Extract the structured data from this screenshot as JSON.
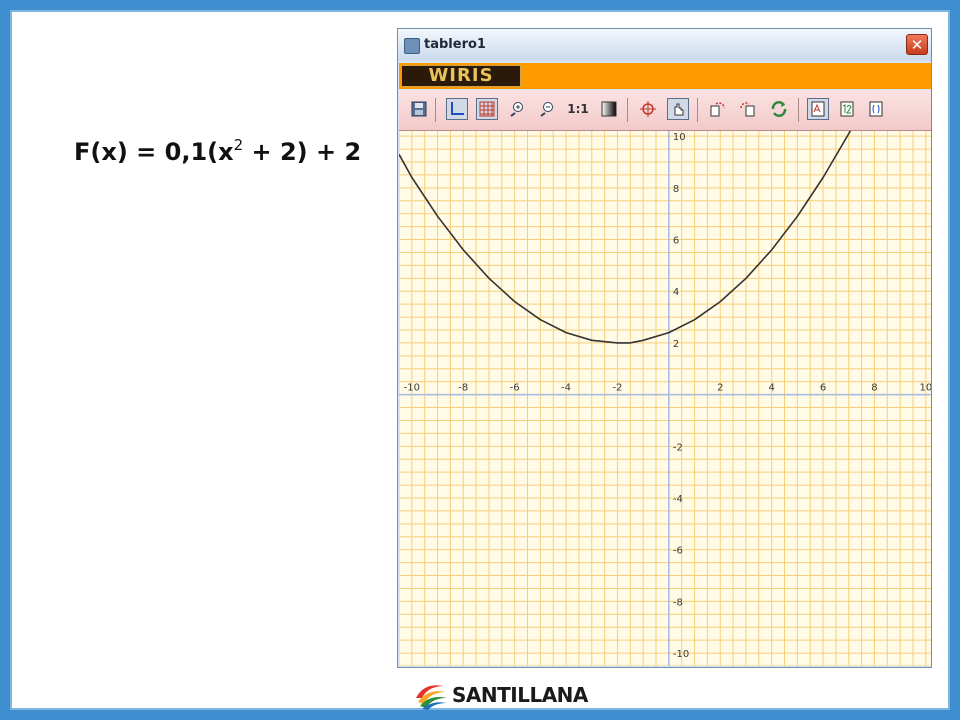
{
  "slide": {
    "equation_left": "F(x) = 0,1(x",
    "equation_sup": "2",
    "equation_right": " + 2) + 2"
  },
  "window": {
    "title": "tablero1",
    "close_glyph": "✕",
    "brand": "WIRIS",
    "toolbar": {
      "zoom_label": "1:1",
      "icons": [
        "save-icon",
        "axes-icon",
        "grid-icon",
        "zoom-in-icon",
        "zoom-out-icon",
        "zoom-reset-icon",
        "contrast-icon",
        "target-icon",
        "hand-icon",
        "undo-icon",
        "redo-icon",
        "refresh-icon",
        "text-icon",
        "number-icon",
        "formula-icon"
      ]
    }
  },
  "graph": {
    "x_ticks": [
      "-10",
      "-8",
      "-6",
      "-4",
      "-2",
      "2",
      "4",
      "6",
      "8",
      "10"
    ],
    "y_ticks": [
      "10",
      "8",
      "6",
      "4",
      "2",
      "-2",
      "-4",
      "-6",
      "-8",
      "-10"
    ],
    "colors": {
      "background": "#fffbe6",
      "grid": "#f6cf7a",
      "axes": "#a9b8e0",
      "curve": "#333333",
      "tick_label": "#3a3a3a"
    }
  },
  "chart_data": {
    "type": "line",
    "function": "F(x) = 0,1(x2 + 2) + 2",
    "xlim": [
      -10.5,
      10.2
    ],
    "ylim": [
      -10.5,
      10.2
    ],
    "grid": true,
    "series": [
      {
        "x": [
          -10.5,
          -10,
          -9,
          -8,
          -7,
          -6,
          -5,
          -4,
          -3,
          -2,
          -1.5,
          -1,
          0,
          1,
          2,
          3,
          4,
          5,
          6,
          7,
          7.5
        ],
        "values": [
          9.3,
          8.4,
          6.9,
          5.6,
          4.5,
          3.6,
          2.9,
          2.4,
          2.1,
          2.0,
          2.0,
          2.1,
          2.4,
          2.9,
          3.6,
          4.5,
          5.6,
          6.9,
          8.4,
          10.1,
          11.0
        ]
      }
    ]
  },
  "footer": {
    "brand": "SANTILLANA"
  }
}
